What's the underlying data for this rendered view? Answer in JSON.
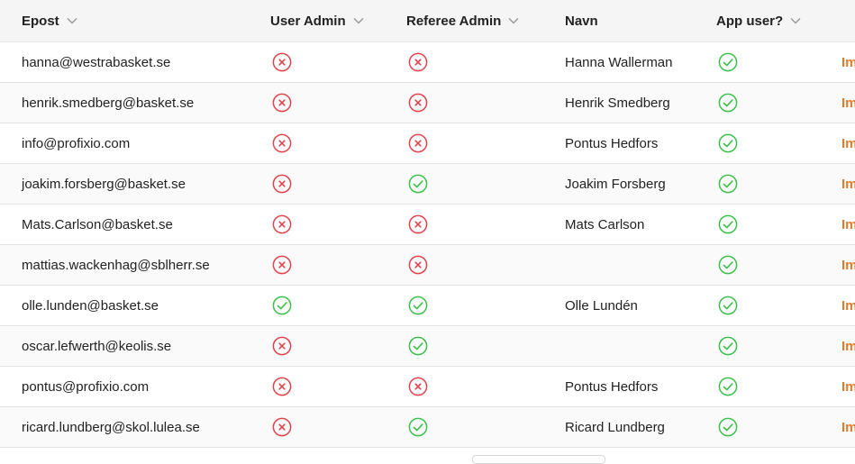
{
  "columns": {
    "email": "Epost",
    "user_admin": "User Admin",
    "referee_admin": "Referee Admin",
    "name": "Navn",
    "app_user": "App user?"
  },
  "colors": {
    "yes": "#3cbf4a",
    "no": "#e0434c",
    "link": "#e07b2c"
  },
  "rows": [
    {
      "email": "hanna@westrabasket.se",
      "user_admin": false,
      "referee_admin": false,
      "name": "Hanna Wallerman",
      "app_user": true,
      "action": "Im"
    },
    {
      "email": "henrik.smedberg@basket.se",
      "user_admin": false,
      "referee_admin": false,
      "name": "Henrik Smedberg",
      "app_user": true,
      "action": "Im"
    },
    {
      "email": "info@profixio.com",
      "user_admin": false,
      "referee_admin": false,
      "name": "Pontus Hedfors",
      "app_user": true,
      "action": "Im"
    },
    {
      "email": "joakim.forsberg@basket.se",
      "user_admin": false,
      "referee_admin": true,
      "name": "Joakim Forsberg",
      "app_user": true,
      "action": "Im"
    },
    {
      "email": "Mats.Carlson@basket.se",
      "user_admin": false,
      "referee_admin": false,
      "name": "Mats Carlson",
      "app_user": true,
      "action": "Im"
    },
    {
      "email": "mattias.wackenhag@sblherr.se",
      "user_admin": false,
      "referee_admin": false,
      "name": "",
      "app_user": true,
      "action": "Im"
    },
    {
      "email": "olle.lunden@basket.se",
      "user_admin": true,
      "referee_admin": true,
      "name": "Olle Lundén",
      "app_user": true,
      "action": "Im"
    },
    {
      "email": "oscar.lefwerth@keolis.se",
      "user_admin": false,
      "referee_admin": true,
      "name": "",
      "app_user": true,
      "action": "Im"
    },
    {
      "email": "pontus@profixio.com",
      "user_admin": false,
      "referee_admin": false,
      "name": "Pontus Hedfors",
      "app_user": true,
      "action": "Im"
    },
    {
      "email": "ricard.lundberg@skol.lulea.se",
      "user_admin": false,
      "referee_admin": true,
      "name": "Ricard Lundberg",
      "app_user": true,
      "action": "Im"
    }
  ]
}
